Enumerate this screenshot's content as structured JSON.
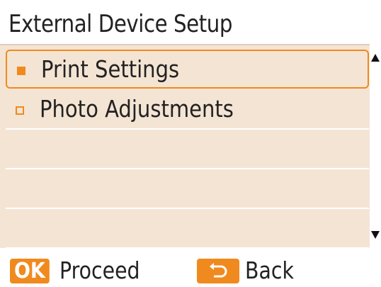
{
  "header": {
    "title": "External Device Setup"
  },
  "menu": {
    "items": [
      {
        "label": "Print Settings",
        "selected": true
      },
      {
        "label": "Photo Adjustments",
        "selected": false
      },
      {
        "label": "",
        "selected": false
      },
      {
        "label": "",
        "selected": false
      },
      {
        "label": "",
        "selected": false
      }
    ]
  },
  "footer": {
    "ok_key": "OK",
    "proceed_label": "Proceed",
    "back_label": "Back",
    "back_icon": "back-arrow-icon"
  },
  "colors": {
    "accent": "#f08a1e",
    "list_background": "#f4e4d4",
    "text": "#222222"
  }
}
